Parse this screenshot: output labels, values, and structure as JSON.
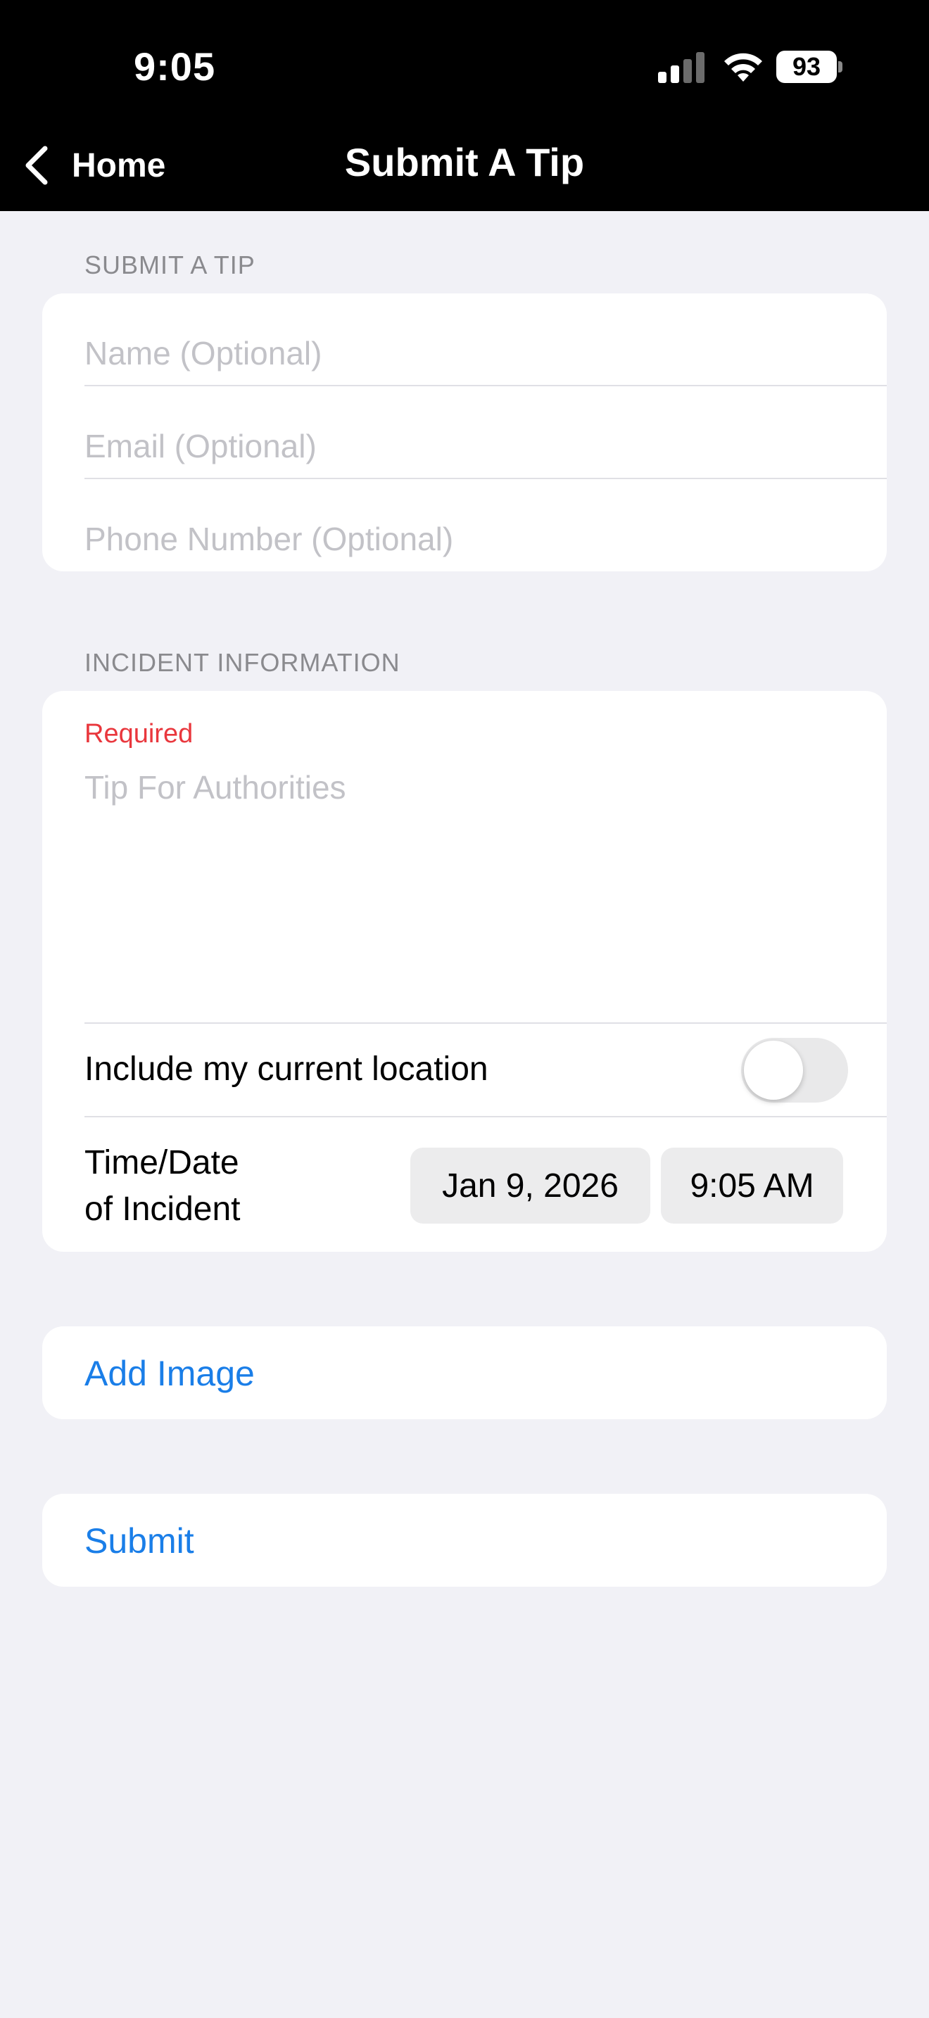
{
  "status_bar": {
    "time": "9:05",
    "battery": "93"
  },
  "nav": {
    "back_label": "Home",
    "title": "Submit A Tip"
  },
  "contact_section": {
    "header": "SUBMIT A TIP",
    "name_placeholder": "Name (Optional)",
    "email_placeholder": "Email (Optional)",
    "phone_placeholder": "Phone Number (Optional)"
  },
  "incident_section": {
    "header": "INCIDENT INFORMATION",
    "required_label": "Required",
    "tip_placeholder": "Tip For Authorities",
    "location_label": "Include my current location",
    "location_enabled": false,
    "datetime_label_line1": "Time/Date",
    "datetime_label_line2": "of Incident",
    "date_value": "Jan 9, 2026",
    "time_value": "9:05 AM"
  },
  "actions": {
    "add_image": "Add Image",
    "submit": "Submit"
  },
  "colors": {
    "accent": "#1a7ee8",
    "required": "#e9373d",
    "background": "#f1f1f6",
    "nav_background": "#000000"
  }
}
